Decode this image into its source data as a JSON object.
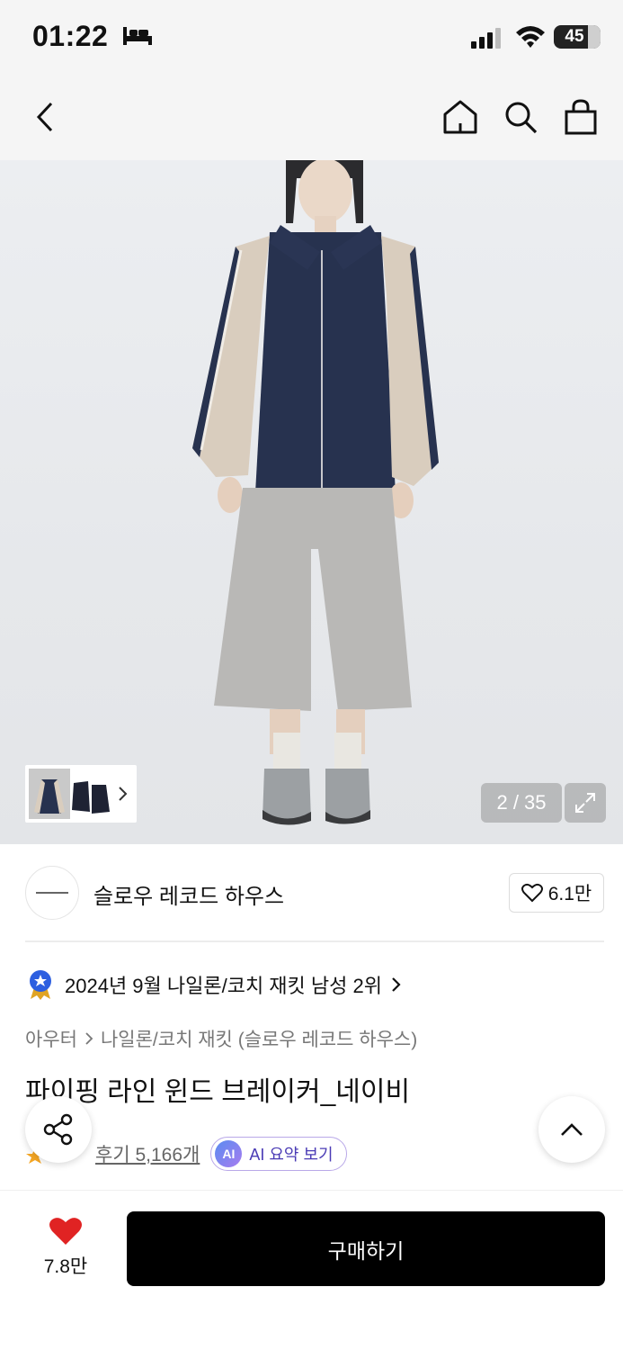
{
  "status_bar": {
    "time": "01:22",
    "battery": "45"
  },
  "gallery": {
    "counter": "2 / 35"
  },
  "brand": {
    "name": "슬로우 레코드 하우스",
    "likes": "6.1만"
  },
  "ranking": {
    "text": "2024년 9월 나일론/코치 재킷 남성 2위"
  },
  "breadcrumb": {
    "category": "아우터",
    "subcategory": "나일론/코치 재킷 (슬로우 레코드 하우스)"
  },
  "product": {
    "title": "파이핑 라인 윈드 브레이커_네이비"
  },
  "reviews": {
    "label": "후기 5,166개",
    "ai_badge": "AI",
    "ai_summary": "AI 요약 보기"
  },
  "bottom_bar": {
    "wish_count": "7.8만",
    "buy_label": "구매하기"
  },
  "colors": {
    "accent": "#e02323",
    "primary": "#000000",
    "ai_purple": "#4a3bb5"
  }
}
